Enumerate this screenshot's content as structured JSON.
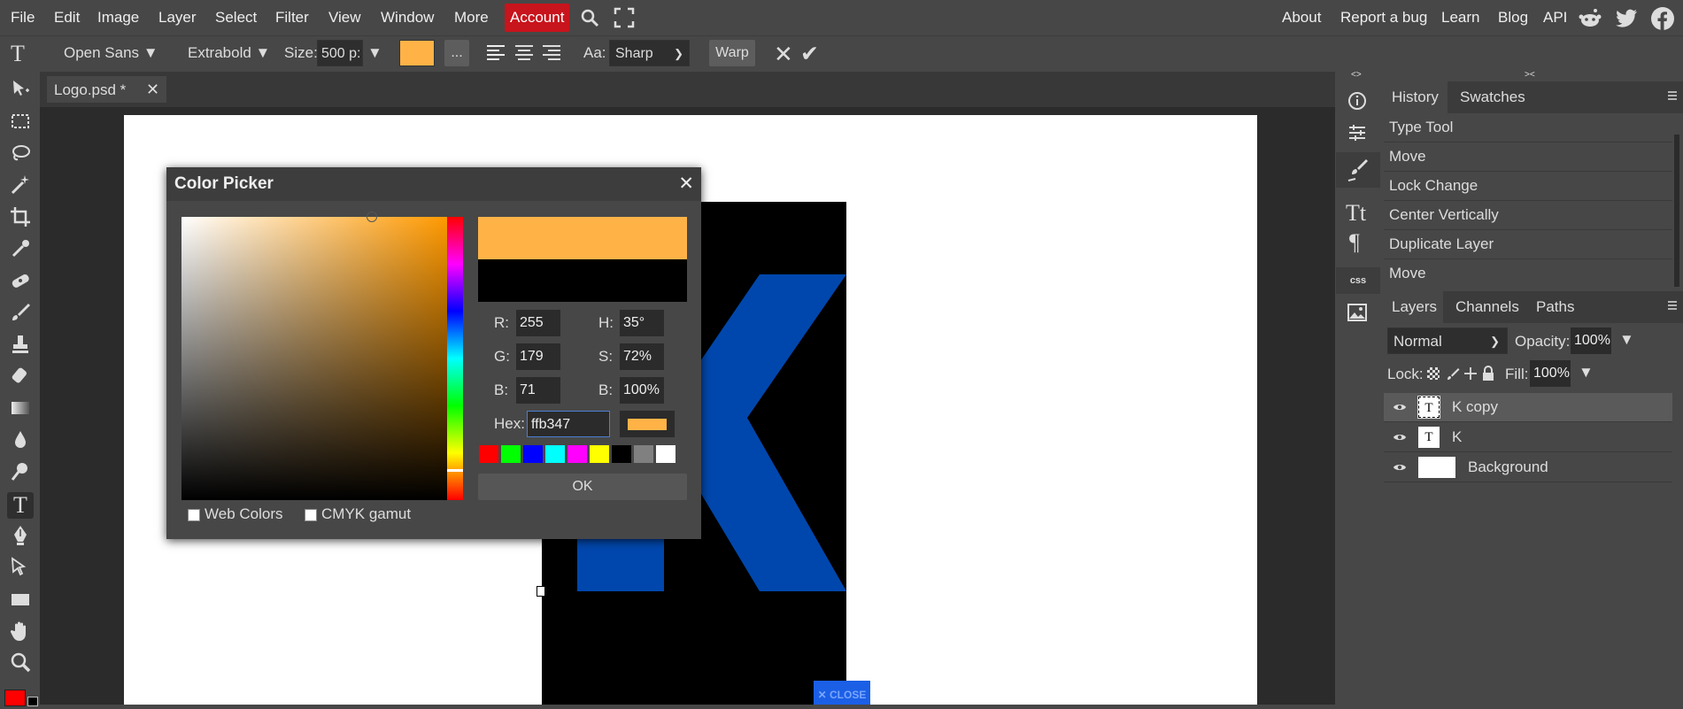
{
  "menu": [
    "File",
    "Edit",
    "Image",
    "Layer",
    "Select",
    "Filter",
    "View",
    "Window",
    "More"
  ],
  "account_label": "Account",
  "right_links": [
    "About",
    "Report a bug",
    "Learn",
    "Blog",
    "API"
  ],
  "options": {
    "font": "Open Sans ▼",
    "weight": "Extrabold ▼",
    "size_label": "Size:",
    "size_value": "500 p:",
    "size_arrow": "▼",
    "more": "...",
    "aa_label": "Aa:",
    "aa_value": "Sharp",
    "warp": "Warp",
    "cancel": "✕",
    "commit": "✔",
    "fill_color": "#ffb347"
  },
  "doc_tab": "Logo.psd *",
  "close_x": "✕",
  "color_picker": {
    "title": "Color Picker",
    "r_label": "R:",
    "r": "255",
    "g_label": "G:",
    "g": "179",
    "b_label": "B:",
    "b": "71",
    "h_label": "H:",
    "h": "35°",
    "s_label": "S:",
    "s": "72%",
    "v_label": "B:",
    "v": "100%",
    "hex_label": "Hex:",
    "hex": "ffb347",
    "web_colors": "Web Colors",
    "cmyk": "CMYK gamut",
    "ok": "OK",
    "new_color": "#ffb347",
    "old_color": "#000000",
    "swatches": [
      "#ff0000",
      "#00ff00",
      "#0000ff",
      "#00ffff",
      "#ff00ff",
      "#ffff00",
      "#000000",
      "#808080",
      "#ffffff"
    ]
  },
  "close_banner": "✕ CLOSE",
  "history": {
    "tabs": [
      "History",
      "Swatches"
    ],
    "items": [
      "Type Tool",
      "Move",
      "Lock Change",
      "Center Vertically",
      "Duplicate Layer",
      "Move"
    ]
  },
  "layers": {
    "tabs": [
      "Layers",
      "Channels",
      "Paths"
    ],
    "blend": "Normal",
    "opacity_label": "Opacity:",
    "opacity": "100%",
    "lock_label": "Lock:",
    "fill_label": "Fill:",
    "fill": "100%",
    "items": [
      "K copy",
      "K",
      "Background"
    ],
    "thumb_letter": "T"
  },
  "side_icons": [
    "css"
  ]
}
